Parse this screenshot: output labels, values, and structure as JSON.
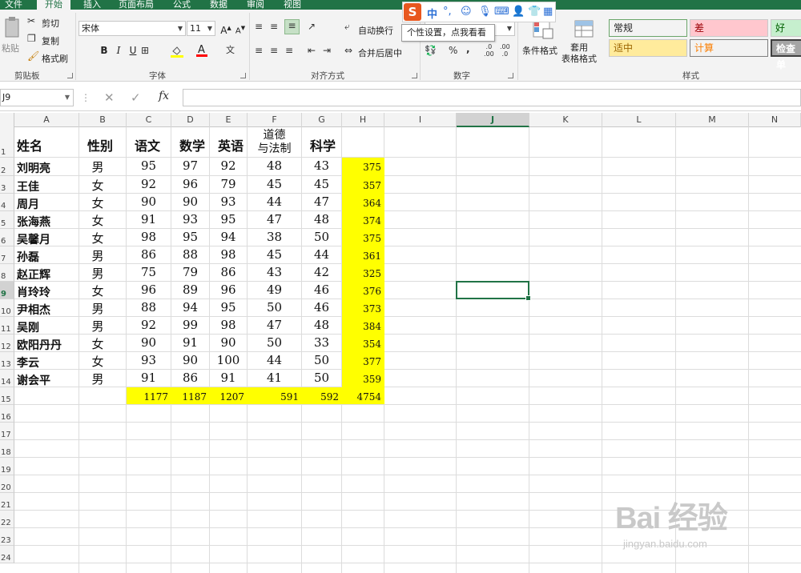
{
  "tabs": [
    "文件",
    "开始",
    "插入",
    "页面布局",
    "公式",
    "数据",
    "审阅",
    "视图"
  ],
  "active_tab": "开始",
  "clipboard": {
    "paste": "粘贴",
    "cut": "剪切",
    "copy": "复制",
    "format_painter": "格式刷",
    "group": "剪贴板"
  },
  "font": {
    "name": "宋体",
    "size": "11",
    "bold": "B",
    "italic": "I",
    "underline": "U",
    "group": "字体"
  },
  "alignment": {
    "wrap": "自动换行",
    "merge": "合并后居中",
    "group": "对齐方式"
  },
  "number": {
    "format": "",
    "group": "数字"
  },
  "styles": {
    "cond_format": "条件格式",
    "table_format": "套用\n表格格式",
    "cells": [
      {
        "label": "常规",
        "color": "#000000",
        "bg": "#ffffff"
      },
      {
        "label": "差",
        "color": "#9c0006",
        "bg": "#ffc7ce"
      },
      {
        "label": "好",
        "color": "#006100",
        "bg": "#c6efce"
      },
      {
        "label": "适中",
        "color": "#9c6500",
        "bg": "#ffeb9c"
      },
      {
        "label": "计算",
        "color": "#fa7d00",
        "bg": "#f2f2f2"
      },
      {
        "label": "检查单",
        "color": "#ffffff",
        "bg": "#a5a5a5"
      }
    ],
    "group": "样式"
  },
  "ime": {
    "logo": "S",
    "mode": "中",
    "tooltip": "个性设置，点我看看"
  },
  "formula_bar": {
    "cell_ref": "J9",
    "fx": "fx",
    "value": ""
  },
  "columns": [
    "A",
    "B",
    "C",
    "D",
    "E",
    "F",
    "G",
    "H",
    "I",
    "J",
    "K",
    "L",
    "M",
    "N"
  ],
  "selected_column": "J",
  "selected_row": "9",
  "rows": [
    "1",
    "2",
    "3",
    "4",
    "5",
    "6",
    "7",
    "8",
    "9",
    "10",
    "11",
    "12",
    "13",
    "14",
    "15",
    "16",
    "17",
    "18",
    "19",
    "20",
    "21",
    "22",
    "23",
    "24"
  ],
  "sheet": {
    "headers": [
      "姓名",
      "性别",
      "语文",
      "数学",
      "英语",
      "道德\n与法制",
      "科学"
    ],
    "students": [
      {
        "name": "刘明亮",
        "gender": "男",
        "scores": [
          95,
          97,
          92,
          48,
          43
        ],
        "total": 375
      },
      {
        "name": "王佳",
        "gender": "女",
        "scores": [
          92,
          96,
          79,
          45,
          45
        ],
        "total": 357
      },
      {
        "name": "周月",
        "gender": "女",
        "scores": [
          90,
          90,
          93,
          44,
          47
        ],
        "total": 364
      },
      {
        "name": "张海燕",
        "gender": "女",
        "scores": [
          91,
          93,
          95,
          47,
          48
        ],
        "total": 374
      },
      {
        "name": "吴馨月",
        "gender": "女",
        "scores": [
          98,
          95,
          94,
          38,
          50
        ],
        "total": 375
      },
      {
        "name": "孙磊",
        "gender": "男",
        "scores": [
          86,
          88,
          98,
          45,
          44
        ],
        "total": 361
      },
      {
        "name": "赵正辉",
        "gender": "男",
        "scores": [
          75,
          79,
          86,
          43,
          42
        ],
        "total": 325
      },
      {
        "name": "肖玲玲",
        "gender": "女",
        "scores": [
          96,
          89,
          96,
          49,
          46
        ],
        "total": 376
      },
      {
        "name": "尹相杰",
        "gender": "男",
        "scores": [
          88,
          94,
          95,
          50,
          46
        ],
        "total": 373
      },
      {
        "name": "吴刚",
        "gender": "男",
        "scores": [
          92,
          99,
          98,
          47,
          48
        ],
        "total": 384
      },
      {
        "name": "欧阳丹丹",
        "gender": "女",
        "scores": [
          90,
          91,
          90,
          50,
          33
        ],
        "total": 354
      },
      {
        "name": "李云",
        "gender": "女",
        "scores": [
          93,
          90,
          100,
          44,
          50
        ],
        "total": 377
      },
      {
        "name": "谢会平",
        "gender": "男",
        "scores": [
          91,
          86,
          91,
          41,
          50
        ],
        "total": 359
      }
    ],
    "sums": [
      1177,
      1187,
      1207,
      591,
      592,
      4754
    ],
    "highlight_color": "#ffff00"
  },
  "watermark": {
    "logo": "Bai 经验",
    "sub": "jingyan.baidu.com"
  }
}
